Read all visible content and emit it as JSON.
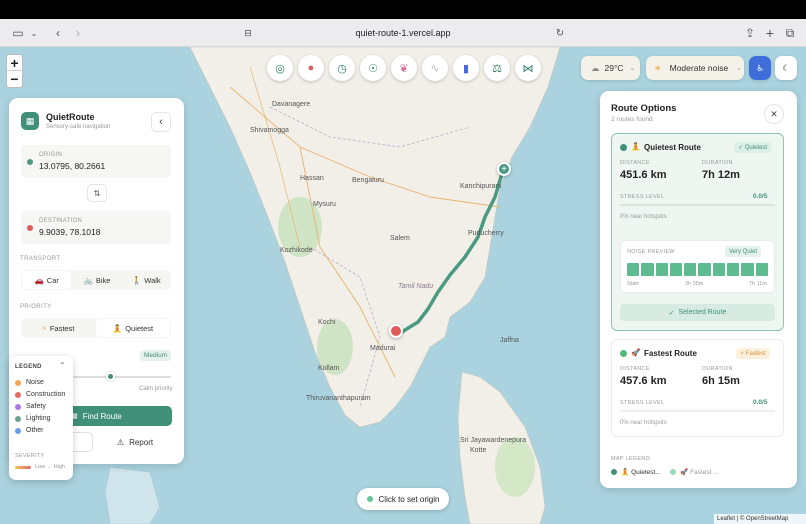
{
  "browser": {
    "url": "quiet-route-1.vercel.app"
  },
  "map": {
    "labels": {
      "davanagere": "Davanagere",
      "shivamogga": "Shivamogga",
      "hassan": "Hassan",
      "bengaluru": "Bengaluru",
      "mysuru": "Mysuru",
      "kanchipuram": "Kanchipuram",
      "salem": "Salem",
      "puducherry": "Puducherry",
      "kozhikode": "Kozhikode",
      "tamil_nadu": "Tamil Nadu",
      "kochi": "Kochi",
      "madurai": "Madurai",
      "kollam": "Kollam",
      "thiruvananthapuram": "Thiruvananthapuram",
      "jaffna": "Jaffna",
      "sri_jayawardenepura": "Sri Jayawardenepura",
      "kotte": "Kotte"
    },
    "hint": "Click to set origin",
    "attribution": "Leaflet | © OpenStreetMap"
  },
  "zoom": {
    "plus": "+",
    "minus": "−"
  },
  "header": {
    "weather": "29°C",
    "noise": "Moderate noise"
  },
  "panel": {
    "title": "QuietRoute",
    "subtitle": "Sensory-safe navigation",
    "origin_label": "ORIGIN",
    "origin_value": "13.0795, 80.2661",
    "dest_label": "DESTINATION",
    "dest_value": "9.9039, 78.1018",
    "transport_label": "TRANSPORT",
    "transport": [
      "Car",
      "Bike",
      "Walk"
    ],
    "priority_label": "PRIORITY",
    "priority": [
      "Fastest",
      "Quietest"
    ],
    "sensitivity_value": "Medium",
    "calm_priority": "Calm priority",
    "find_route": "Find Route",
    "report": "Report"
  },
  "legend": {
    "title": "LEGEND",
    "items": [
      {
        "label": "Noise",
        "color": "#f2a65a"
      },
      {
        "label": "Construction",
        "color": "#e46b6b"
      },
      {
        "label": "Safety",
        "color": "#a77be0"
      },
      {
        "label": "Lighting",
        "color": "#6aa38f"
      },
      {
        "label": "Other",
        "color": "#6c9be6"
      }
    ],
    "severity_label": "SEVERITY",
    "severity_scale": "Low → High"
  },
  "route_options": {
    "title": "Route Options",
    "count": "2 routes found",
    "routes": [
      {
        "name": "Quietest Route",
        "badge": "✓ Quietest",
        "distance_label": "DISTANCE",
        "distance": "451.6 km",
        "duration_label": "DURATION",
        "duration": "7h 12m",
        "stress_label": "STRESS LEVEL",
        "stress": "0.0/5",
        "hotspots": "0% near hotspots",
        "noise_preview_label": "NOISE PREVIEW",
        "noise_preview_value": "Very Quiet",
        "timeline": [
          "Start",
          "3h 35m",
          "7h 11m"
        ],
        "selected": "Selected Route"
      },
      {
        "name": "Fastest Route",
        "badge": "⚡ Fastest",
        "distance_label": "DISTANCE",
        "distance": "457.6 km",
        "duration_label": "DURATION",
        "duration": "6h 15m",
        "stress_label": "STRESS LEVEL",
        "stress": "0.0/5",
        "hotspots": "0% near hotspots"
      }
    ],
    "map_legend_label": "MAP LEGEND",
    "map_legend_items": [
      "Quietest...",
      "Fastest ..."
    ]
  },
  "colors": {
    "accent": "#3f8f79",
    "route": "#4a9a82",
    "pin": "#e05a5a"
  }
}
